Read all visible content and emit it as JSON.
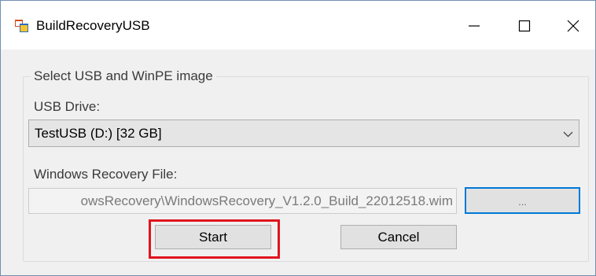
{
  "window": {
    "title": "BuildRecoveryUSB",
    "minimize_symbol": "—",
    "maximize_symbol": "☐",
    "close_symbol": "✕"
  },
  "group": {
    "legend": "Select USB and WinPE image"
  },
  "usb": {
    "label": "USB Drive:",
    "selected": "TestUSB (D:) [32 GB]"
  },
  "recovery": {
    "label": "Windows Recovery File:",
    "value": "owsRecovery\\WindowsRecovery_V1.2.0_Build_22012518.wim",
    "browse_label": "..."
  },
  "buttons": {
    "start": "Start",
    "cancel": "Cancel"
  },
  "colors": {
    "highlight": "#e0141e",
    "focus_border": "#0078d7"
  },
  "icons": {
    "app": "app-window-icon",
    "dropdown": "chevron-down-icon"
  }
}
